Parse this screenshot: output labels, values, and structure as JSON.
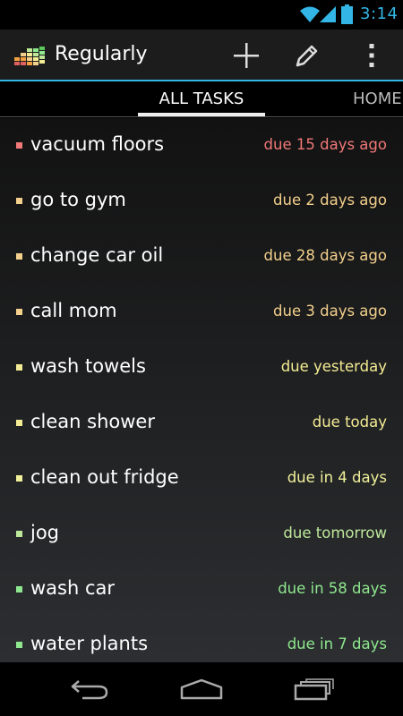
{
  "status_bar": {
    "time": "3:14",
    "accent_color": "#33b5e5",
    "icons": [
      "wifi-icon",
      "signal-icon",
      "battery-icon"
    ]
  },
  "action_bar": {
    "title": "Regularly",
    "icons": [
      "app-logo-icon",
      "add-icon",
      "edit-icon",
      "overflow-menu-icon"
    ]
  },
  "tabs": [
    {
      "label": "ALL TASKS",
      "selected": true
    },
    {
      "label": "HOME",
      "selected": false
    }
  ],
  "tasks": [
    {
      "name": "vacuum floors",
      "due": "due 15 days ago",
      "color": "#f07878"
    },
    {
      "name": "go to gym",
      "due": "due 2 days ago",
      "color": "#f3d08c"
    },
    {
      "name": "change car oil",
      "due": "due 28 days ago",
      "color": "#f3d08c"
    },
    {
      "name": "call mom",
      "due": "due 3 days ago",
      "color": "#f3d08c"
    },
    {
      "name": "wash towels",
      "due": "due yesterday",
      "color": "#f4ec94"
    },
    {
      "name": "clean shower",
      "due": "due today",
      "color": "#f4ec94"
    },
    {
      "name": "clean out fridge",
      "due": "due in 4 days",
      "color": "#f1f19a"
    },
    {
      "name": "jog",
      "due": "due tomorrow",
      "color": "#bde89a"
    },
    {
      "name": "wash car",
      "due": "due in 58 days",
      "color": "#8fe88f"
    },
    {
      "name": "water plants",
      "due": "due in 7 days",
      "color": "#8fe88f"
    }
  ],
  "nav_bar": {
    "icons": [
      "back-icon",
      "home-icon",
      "recent-apps-icon"
    ]
  }
}
